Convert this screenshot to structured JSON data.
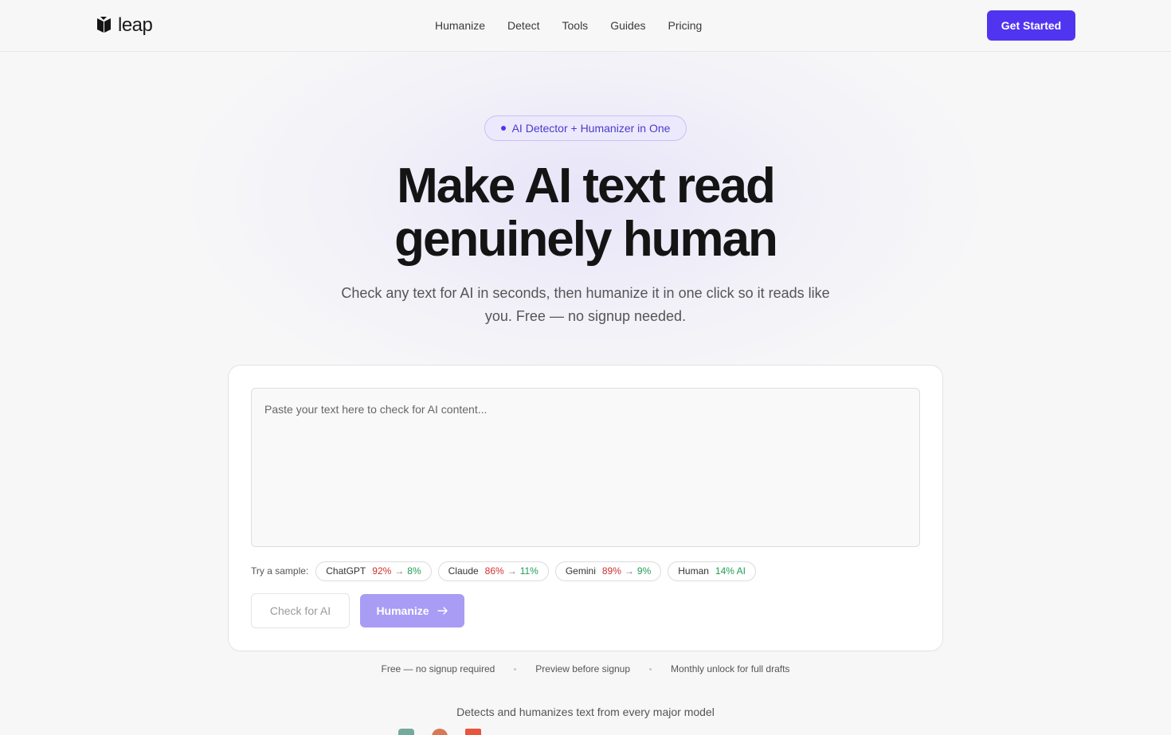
{
  "header": {
    "logo_text": "leap",
    "nav": [
      "Humanize",
      "Detect",
      "Tools",
      "Guides",
      "Pricing"
    ],
    "cta_label": "Get Started"
  },
  "hero": {
    "badge": "AI Detector + Humanizer in One",
    "title_line1": "Make AI text read",
    "title_line2": "genuinely human",
    "subtitle": "Check any text for AI in seconds, then humanize it in one click so it reads like you. Free — no signup needed."
  },
  "editor": {
    "placeholder": "Paste your text here to check for AI content...",
    "value": "",
    "samples_label": "Try a sample:",
    "samples": [
      {
        "name": "ChatGPT",
        "before": "92%",
        "arrow": "→",
        "after": "8%"
      },
      {
        "name": "Claude",
        "before": "86%",
        "arrow": "→",
        "after": "11%"
      },
      {
        "name": "Gemini",
        "before": "89%",
        "arrow": "→",
        "after": "9%"
      },
      {
        "name": "Human",
        "after": "14% AI"
      }
    ],
    "check_label": "Check for AI",
    "humanize_label": "Humanize"
  },
  "perks": [
    "Free — no signup required",
    "Preview before signup",
    "Monthly unlock for full drafts"
  ],
  "models": {
    "title": "Detects and humanizes text from every major model"
  },
  "colors": {
    "accent": "#4f35f0",
    "accent_disabled": "#a89cf5",
    "ai_score": "#d23030",
    "human_score": "#1f9d55"
  }
}
